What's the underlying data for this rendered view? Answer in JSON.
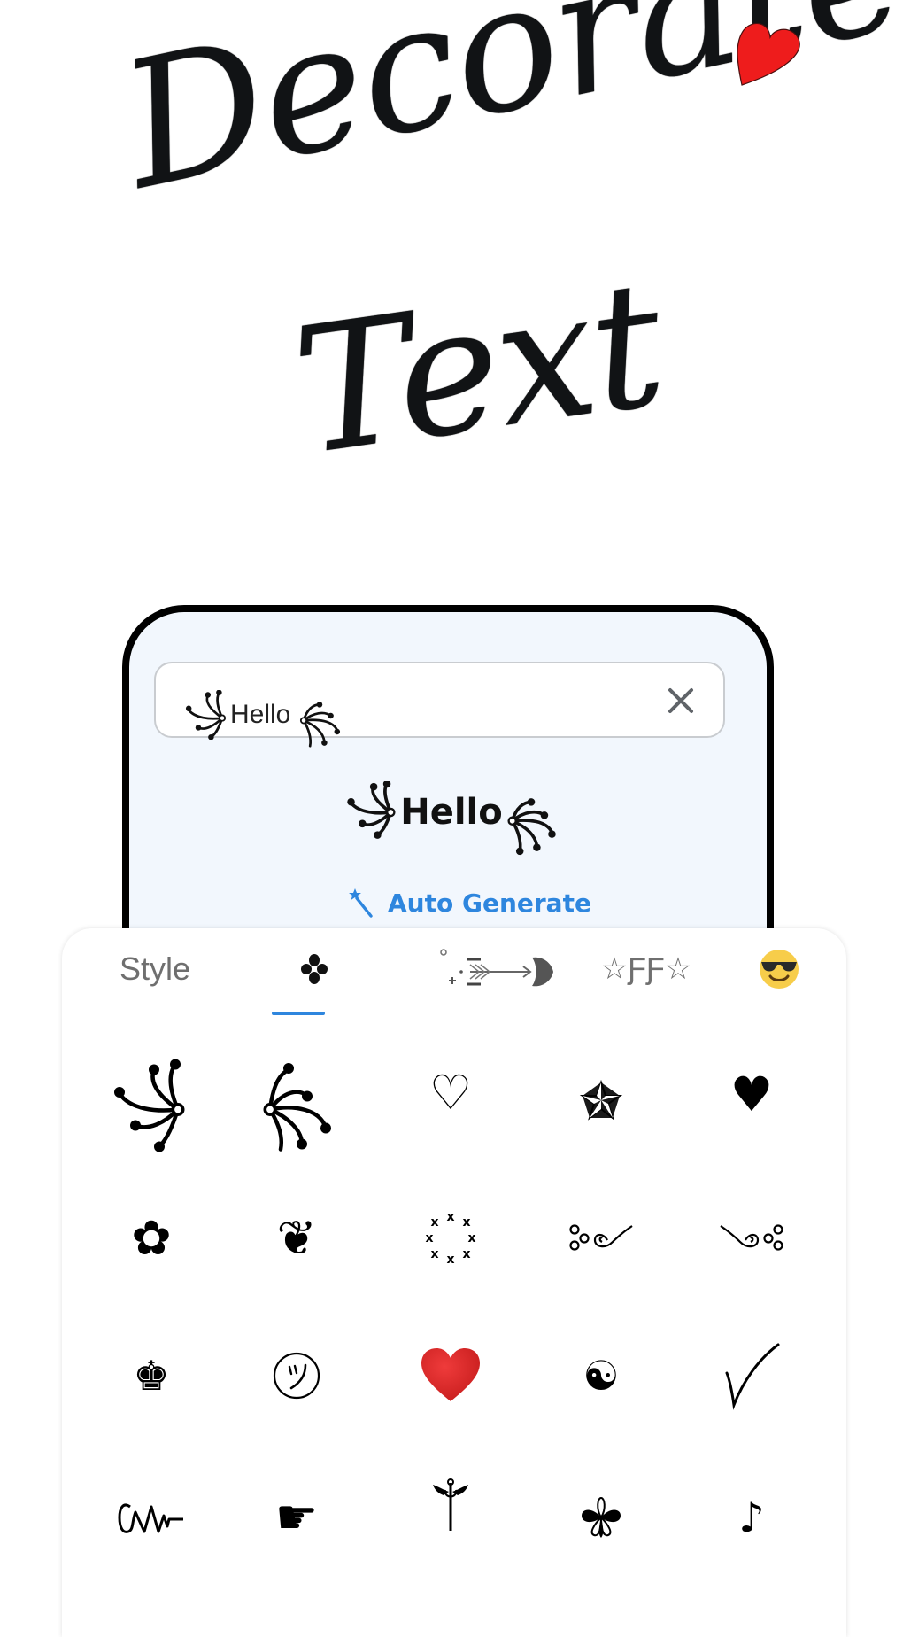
{
  "hero": {
    "line1": "Decorate",
    "line2": "Text",
    "accent_icon": "red-heart-icon",
    "accent_color": "#ee1c1c"
  },
  "editor": {
    "input_value": "Hello",
    "input_prefix_ornament": "left-swirl-ornament",
    "input_suffix_ornament": "right-swirl-ornament",
    "clear_icon": "close-icon",
    "preview_text": "Hello",
    "auto_generate_label": "Auto Generate",
    "auto_generate_icon": "magic-wand-icon",
    "accent_color": "#2e86de",
    "frame_background": "#f2f7fd"
  },
  "tabs": {
    "active_index": 1,
    "items": [
      {
        "label": "Style",
        "name": "tab-style"
      },
      {
        "label": "✤",
        "name": "tab-symbols"
      },
      {
        "label": "°₊·‿̩͙⊱⟿❥",
        "name": "tab-arrow-decor"
      },
      {
        "label": "☆ƑƑ☆",
        "name": "tab-fancy-font"
      },
      {
        "label": "😎",
        "name": "tab-emoji"
      }
    ]
  },
  "symbols": {
    "rows": [
      [
        "left-swirl-ornament",
        "right-swirl-ornament",
        "white-heart-suit",
        "nautical-star",
        "black-heart-suit"
      ],
      [
        "flower",
        "heart-with-sprout",
        "ring-of-x",
        "circles-swirl-left",
        "swirl-circles-right"
      ],
      [
        "chess-king",
        "smiley-face",
        "red-heart",
        "yin-yang",
        "check-mark"
      ],
      [
        "squiggle-zigzag",
        "pointing-hand",
        "caduceus",
        "four-petal-flower",
        "music-note"
      ]
    ],
    "glyphs": {
      "white-heart-suit": "♡",
      "nautical-star": "✯",
      "black-heart-suit": "♥",
      "flower": "✿",
      "heart-with-sprout": "❦",
      "chess-king": "♚",
      "yin-yang": "☯",
      "check-mark": "✓",
      "pointing-hand": "☛",
      "caduceus": "☤",
      "four-petal-flower": "❀",
      "music-note": "♪"
    }
  }
}
